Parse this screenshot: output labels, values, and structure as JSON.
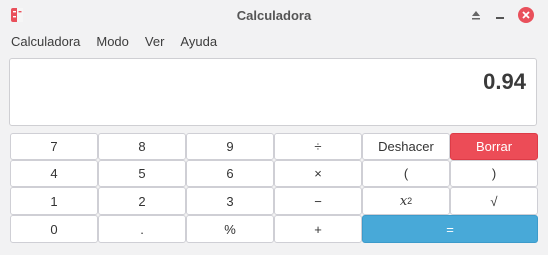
{
  "window": {
    "title": "Calculadora"
  },
  "menu": {
    "items": [
      "Calculadora",
      "Modo",
      "Ver",
      "Ayuda"
    ]
  },
  "display": {
    "value": "0.94"
  },
  "keys": {
    "k7": "7",
    "k8": "8",
    "k9": "9",
    "divide": "÷",
    "undo": "Deshacer",
    "clear": "Borrar",
    "k4": "4",
    "k5": "5",
    "k6": "6",
    "multiply": "×",
    "lparen": "(",
    "rparen": ")",
    "k1": "1",
    "k2": "2",
    "k3": "3",
    "subtract": "−",
    "square_base": "x",
    "square_exp": "2",
    "sqrt": "√",
    "k0": "0",
    "decimal": ".",
    "percent": "%",
    "add": "+",
    "equals": "="
  },
  "colors": {
    "clear_bg": "#ec4c57",
    "equals_bg": "#48a9d8",
    "close_btn": "#e9505b"
  }
}
